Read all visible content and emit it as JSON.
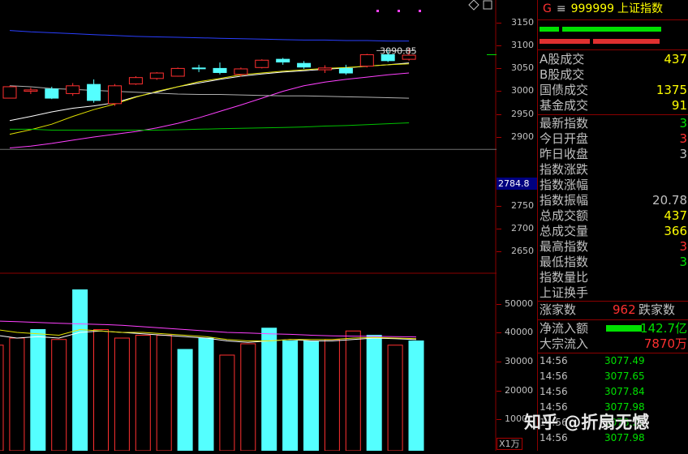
{
  "header": {
    "prefix": "G",
    "menu_glyph": "≡",
    "code": "999999",
    "name": "上证指数"
  },
  "price_axis": {
    "ticks": [
      "3150",
      "3100",
      "3050",
      "3000",
      "2950",
      "2900",
      "2750",
      "2700",
      "2650"
    ],
    "current_price": "2784.8"
  },
  "volume_axis": {
    "ticks": [
      "50000",
      "40000",
      "30000",
      "20000",
      "1000"
    ],
    "unit": "X1万"
  },
  "chart_data": {
    "type": "candlestick",
    "candles": [
      {
        "open": 2985,
        "close": 3010,
        "high": 3012,
        "low": 2985
      },
      {
        "open": 3000,
        "close": 3003,
        "high": 3008,
        "low": 2994
      },
      {
        "open": 3005,
        "close": 2985,
        "high": 3010,
        "low": 2983
      },
      {
        "open": 2995,
        "close": 3012,
        "high": 3018,
        "low": 2990
      },
      {
        "open": 3015,
        "close": 2980,
        "high": 3026,
        "low": 2975
      },
      {
        "open": 2973,
        "close": 3012,
        "high": 3016,
        "low": 2968
      },
      {
        "open": 3016,
        "close": 3030,
        "high": 3033,
        "low": 3014
      },
      {
        "open": 3028,
        "close": 3040,
        "high": 3042,
        "low": 3025
      },
      {
        "open": 3033,
        "close": 3050,
        "high": 3052,
        "low": 3032
      },
      {
        "open": 3051,
        "close": 3050,
        "high": 3058,
        "low": 3042
      },
      {
        "open": 3050,
        "close": 3041,
        "high": 3063,
        "low": 3037
      },
      {
        "open": 3037,
        "close": 3049,
        "high": 3052,
        "low": 3032
      },
      {
        "open": 3052,
        "close": 3068,
        "high": 3070,
        "low": 3050
      },
      {
        "open": 3070,
        "close": 3064,
        "high": 3073,
        "low": 3058
      },
      {
        "open": 3061,
        "close": 3053,
        "high": 3066,
        "low": 3049
      },
      {
        "open": 3047,
        "close": 3051,
        "high": 3057,
        "low": 3040
      },
      {
        "open": 3050,
        "close": 3040,
        "high": 3058,
        "low": 3036
      },
      {
        "open": 3055,
        "close": 3080,
        "high": 3082,
        "low": 3052
      },
      {
        "open": 3080,
        "close": 3067,
        "high": 3092,
        "low": 3064
      },
      {
        "open": 3070,
        "close": 3079,
        "high": 3094,
        "low": 3067
      }
    ],
    "max_price_label": "3090.85",
    "ma_lines": [
      {
        "name": "blue",
        "color": "#2a3fff",
        "values": [
          3133,
          3130,
          3128,
          3126,
          3124,
          3122,
          3120,
          3119,
          3118,
          3117,
          3116,
          3115,
          3114,
          3113,
          3112,
          3112,
          3111,
          3111,
          3110,
          3110
        ]
      },
      {
        "name": "white",
        "color": "#ffffff",
        "values": [
          2936,
          2945,
          2955,
          2963,
          2968,
          2975,
          2988,
          2998,
          3010,
          3018,
          3026,
          3033,
          3038,
          3042,
          3045,
          3048,
          3051,
          3055,
          3058,
          3062
        ]
      },
      {
        "name": "yellow",
        "color": "#e0e000",
        "values": [
          2906,
          2916,
          2928,
          2945,
          2960,
          2972,
          2987,
          3000,
          3010,
          3021,
          3028,
          3036,
          3040,
          3044,
          3047,
          3050,
          3052,
          3055,
          3058,
          3060
        ]
      },
      {
        "name": "magenta",
        "color": "#ff40ff",
        "values": [
          2876,
          2880,
          2886,
          2893,
          2900,
          2906,
          2912,
          2920,
          2930,
          2942,
          2956,
          2970,
          2985,
          3000,
          3012,
          3020,
          3026,
          3031,
          3036,
          3040
        ]
      },
      {
        "name": "gray",
        "color": "#b0b0b0",
        "values": [
          3012,
          3010,
          3006,
          3004,
          3002,
          3000,
          2998,
          2996,
          2994,
          2993,
          2993,
          2992,
          2991,
          2990,
          2990,
          2989,
          2988,
          2987,
          2986,
          2985
        ]
      },
      {
        "name": "green",
        "color": "#00c000",
        "values": [
          2917,
          2917,
          2915,
          2915,
          2915,
          2915,
          2915,
          2915,
          2916,
          2917,
          2918,
          2919,
          2920,
          2921,
          2922,
          2924,
          2925,
          2927,
          2929,
          2931
        ]
      }
    ],
    "horizontal_level": 2873,
    "volumes": [
      {
        "value": 35500,
        "color": "red"
      },
      {
        "value": 38000,
        "color": "red"
      },
      {
        "value": 41000,
        "color": "cyan"
      },
      {
        "value": 37500,
        "color": "red"
      },
      {
        "value": 55000,
        "color": "cyan"
      },
      {
        "value": 41000,
        "color": "red"
      },
      {
        "value": 38000,
        "color": "red"
      },
      {
        "value": 39000,
        "color": "red"
      },
      {
        "value": 39000,
        "color": "red"
      },
      {
        "value": 34000,
        "color": "cyan"
      },
      {
        "value": 38000,
        "color": "cyan"
      },
      {
        "value": 32000,
        "color": "red"
      },
      {
        "value": 36000,
        "color": "red"
      },
      {
        "value": 41500,
        "color": "cyan"
      },
      {
        "value": 37000,
        "color": "cyan"
      },
      {
        "value": 37000,
        "color": "cyan"
      },
      {
        "value": 37500,
        "color": "red"
      },
      {
        "value": 40500,
        "color": "red"
      },
      {
        "value": 39000,
        "color": "cyan"
      },
      {
        "value": 35500,
        "color": "red"
      },
      {
        "value": 37000,
        "color": "cyan"
      }
    ],
    "vol_ma_lines": [
      {
        "name": "white",
        "color": "#ffffff",
        "values": [
          39000,
          38000,
          38500,
          38000,
          40000,
          40500,
          40000,
          39500,
          39000,
          38500,
          38000,
          37000,
          36500,
          37000,
          37500,
          37000,
          37000,
          37500,
          38000,
          37800,
          37500
        ]
      },
      {
        "name": "yellow",
        "color": "#e0e000",
        "values": [
          41000,
          40000,
          39500,
          39000,
          41000,
          40500,
          40000,
          40000,
          39500,
          39000,
          38500,
          37500,
          37000,
          37000,
          37500,
          37500,
          37500,
          38000,
          38200,
          38000,
          37800
        ]
      },
      {
        "name": "magenta",
        "color": "#ff40ff",
        "values": [
          44000,
          43800,
          43500,
          43200,
          43000,
          42800,
          42500,
          42000,
          41500,
          41000,
          40500,
          40000,
          39800,
          39500,
          39300,
          39000,
          38800,
          38700,
          38600,
          38500,
          38400
        ]
      }
    ]
  },
  "summary": {
    "a_share_turnover": {
      "label": "A股成交",
      "value": "437"
    },
    "b_share_turnover": {
      "label": "B股成交",
      "value": ""
    },
    "bond_turnover": {
      "label": "国债成交",
      "value": "1375"
    },
    "fund_turnover": {
      "label": "基金成交",
      "value": "91"
    }
  },
  "quote": [
    {
      "label": "最新指数",
      "value": "3",
      "color": "#00e000"
    },
    {
      "label": "今日开盘",
      "value": "3",
      "color": "#ff3030"
    },
    {
      "label": "昨日收盘",
      "value": "3",
      "color": "#c0c0c0"
    },
    {
      "label": "指数涨跌",
      "value": "",
      "color": "#00e000"
    },
    {
      "label": "指数涨幅",
      "value": "",
      "color": "#00e000"
    },
    {
      "label": "指数振幅",
      "value": "20.78",
      "color": "#c0c0c0"
    },
    {
      "label": "总成交额",
      "value": "437",
      "color": "#ffff00"
    },
    {
      "label": "总成交量",
      "value": "366",
      "color": "#ffff00"
    },
    {
      "label": "最高指数",
      "value": "3",
      "color": "#ff3030"
    },
    {
      "label": "最低指数",
      "value": "3",
      "color": "#00e000"
    },
    {
      "label": "指数量比",
      "value": "",
      "color": "#c0c0c0"
    },
    {
      "label": "上证换手",
      "value": "",
      "color": "#c0c0c0"
    }
  ],
  "breadth": {
    "up_label": "涨家数",
    "up_value": "962",
    "down_label": "跌家数"
  },
  "flow": {
    "net_label": "净流入额",
    "net_value": "-142.7亿",
    "block_label": "大宗流入",
    "block_value": "7870万"
  },
  "ticks": [
    {
      "time": "14:56",
      "price": "3077.49"
    },
    {
      "time": "14:56",
      "price": "3077.65"
    },
    {
      "time": "14:56",
      "price": "3077.84"
    },
    {
      "time": "14:56",
      "price": "3077.98"
    },
    {
      "time": "14:56",
      "price": "3078.22"
    },
    {
      "time": "14:56",
      "price": "3077.98"
    }
  ],
  "watermark": "知乎 @折扇无憾"
}
